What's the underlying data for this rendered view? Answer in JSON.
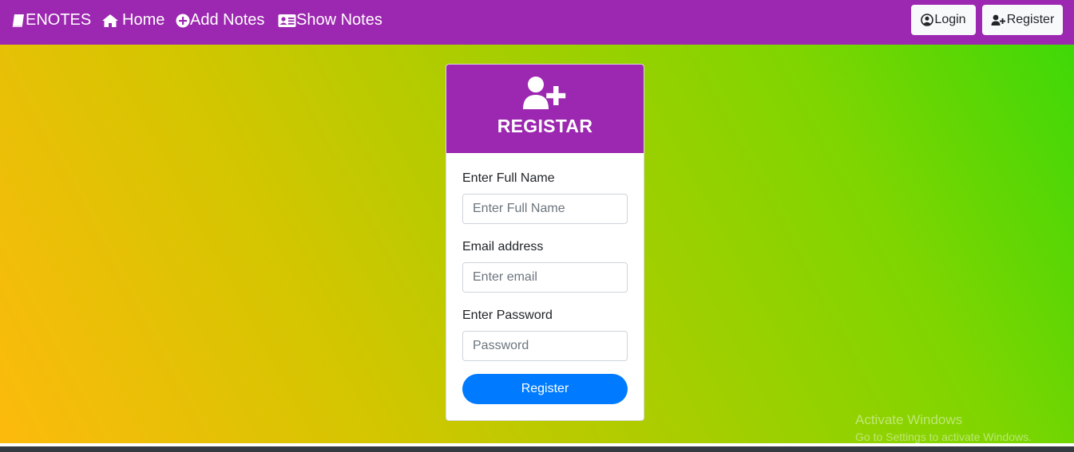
{
  "navbar": {
    "brand": "ENOTES",
    "links": [
      {
        "label": "Home",
        "icon": "home-icon"
      },
      {
        "label": "Add Notes",
        "icon": "plus-circle-icon"
      },
      {
        "label": "Show Notes",
        "icon": "id-card-icon"
      }
    ],
    "login_label": "Login",
    "register_label": "Register"
  },
  "form": {
    "title": "REGISTAR",
    "fullname_label": "Enter Full Name",
    "fullname_placeholder": "Enter Full Name",
    "email_label": "Email address",
    "email_placeholder": "Enter email",
    "password_label": "Enter Password",
    "password_placeholder": "Password",
    "submit_label": "Register"
  },
  "watermark": {
    "line1": "Activate Windows",
    "line2": "Go to Settings to activate Windows."
  },
  "colors": {
    "navbar": "#9c27b0",
    "card_header": "#9c27b0",
    "primary_button": "#007bff",
    "gradient_start": "#fdba0c",
    "gradient_end": "#3fd808"
  }
}
